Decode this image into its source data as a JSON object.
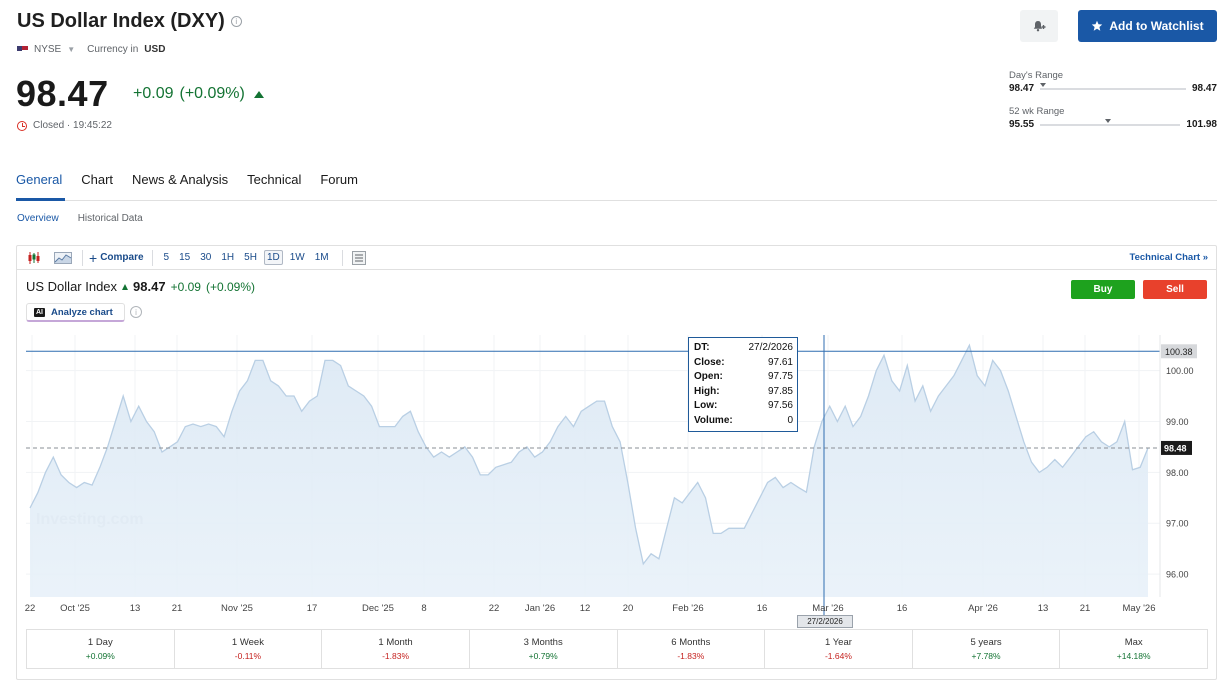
{
  "header": {
    "title": "US Dollar Index (DXY)",
    "exchange": "NYSE",
    "currency_label": "Currency in",
    "currency": "USD",
    "price": "98.47",
    "change": "+0.09",
    "change_pct": "(+0.09%)",
    "status": "Closed · 19:45:22",
    "watchlist_label": "Add to Watchlist"
  },
  "ranges": {
    "day": {
      "label": "Day's Range",
      "low": "98.47",
      "high": "98.47",
      "position": 0.0
    },
    "week52": {
      "label": "52 wk Range",
      "low": "95.55",
      "high": "101.98",
      "position": 0.46
    }
  },
  "tabs": [
    "General",
    "Chart",
    "News & Analysis",
    "Technical",
    "Forum"
  ],
  "subtabs": [
    "Overview",
    "Historical Data"
  ],
  "toolbar": {
    "compare_label": "Compare",
    "intervals": [
      "5",
      "15",
      "30",
      "1H",
      "5H",
      "1D",
      "1W",
      "1M"
    ],
    "active_interval": "1D",
    "technical_chart_label": "Technical Chart »"
  },
  "legend": {
    "name": "US Dollar Index",
    "price": "98.47",
    "change": "+0.09",
    "change_pct": "(+0.09%)",
    "analyze_label": "Analyze chart",
    "ai_badge": "AI"
  },
  "trade": {
    "buy": "Buy",
    "sell": "Sell"
  },
  "tooltip": {
    "rows": [
      {
        "k": "DT:",
        "v": "27/2/2026"
      },
      {
        "k": "Close:",
        "v": "97.61"
      },
      {
        "k": "Open:",
        "v": "97.75"
      },
      {
        "k": "High:",
        "v": "97.85"
      },
      {
        "k": "Low:",
        "v": "97.56"
      },
      {
        "k": "Volume:",
        "v": "0"
      }
    ]
  },
  "crosshair_date": "27/2/2026",
  "watermark": "Investing.com",
  "chart_data": {
    "type": "area",
    "y_ticks": [
      "100.00",
      "99.00",
      "98.00",
      "97.00",
      "96.00"
    ],
    "ylim": [
      95.55,
      100.7
    ],
    "price_labels": {
      "high_line": "100.38",
      "current": "98.48"
    },
    "x_tick_labels": [
      "22",
      "Oct '25",
      "13",
      "21",
      "Nov '25",
      "17",
      "Dec '25",
      "8",
      "22",
      "Jan '26",
      "12",
      "20",
      "Feb '26",
      "16",
      "Mar '26",
      "16",
      "Apr '26",
      "13",
      "21",
      "May '26"
    ],
    "values": [
      97.3,
      97.6,
      98.0,
      98.3,
      97.95,
      97.8,
      97.7,
      97.8,
      97.75,
      98.1,
      98.5,
      99.0,
      99.5,
      99.0,
      99.3,
      99.0,
      98.8,
      98.4,
      98.5,
      98.6,
      98.9,
      98.95,
      98.9,
      98.95,
      98.9,
      98.7,
      99.2,
      99.6,
      99.8,
      100.2,
      100.2,
      99.8,
      99.7,
      99.5,
      99.5,
      99.2,
      99.4,
      99.5,
      100.2,
      100.2,
      100.1,
      99.7,
      99.6,
      99.5,
      99.3,
      98.9,
      98.9,
      98.9,
      99.1,
      99.2,
      98.8,
      98.5,
      98.3,
      98.4,
      98.3,
      98.4,
      98.5,
      98.3,
      97.95,
      97.95,
      98.1,
      98.15,
      98.2,
      98.4,
      98.5,
      98.3,
      98.4,
      98.6,
      98.9,
      99.1,
      98.9,
      99.2,
      99.3,
      99.4,
      99.4,
      98.9,
      98.6,
      97.8,
      96.9,
      96.2,
      96.4,
      96.3,
      96.9,
      97.5,
      97.4,
      97.6,
      97.8,
      97.5,
      96.8,
      96.8,
      96.9,
      96.9,
      96.9,
      97.2,
      97.5,
      97.8,
      97.9,
      97.7,
      97.8,
      97.7,
      97.61,
      98.5,
      99.0,
      99.3,
      99.0,
      99.3,
      98.9,
      99.1,
      99.5,
      100.0,
      100.3,
      99.8,
      99.6,
      100.1,
      99.4,
      99.7,
      99.2,
      99.5,
      99.7,
      99.9,
      100.2,
      100.5,
      99.9,
      99.7,
      100.2,
      100.0,
      99.6,
      99.1,
      98.6,
      98.2,
      98.0,
      98.1,
      98.25,
      98.1,
      98.3,
      98.5,
      98.7,
      98.8,
      98.6,
      98.5,
      98.6,
      99.0,
      98.05,
      98.1,
      98.48
    ]
  },
  "performance": [
    {
      "label": "1 Day",
      "value": "+0.09%"
    },
    {
      "label": "1 Week",
      "value": "-0.11%"
    },
    {
      "label": "1 Month",
      "value": "-1.83%"
    },
    {
      "label": "3 Months",
      "value": "+0.79%"
    },
    {
      "label": "6 Months",
      "value": "-1.83%"
    },
    {
      "label": "1 Year",
      "value": "-1.64%"
    },
    {
      "label": "5 years",
      "value": "+7.78%"
    },
    {
      "label": "Max",
      "value": "+14.18%"
    }
  ]
}
